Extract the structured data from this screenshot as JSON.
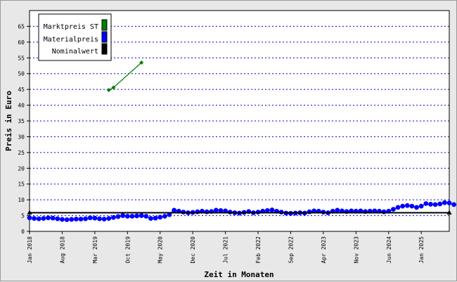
{
  "chart_data": {
    "type": "line",
    "xlabel": "Zeit in Monaten",
    "ylabel": "Preis in Euro",
    "ylim": [
      0,
      70
    ],
    "y_ticks": [
      0,
      5,
      10,
      15,
      20,
      25,
      30,
      35,
      40,
      45,
      50,
      55,
      60,
      65
    ],
    "x_range": [
      "2018-01",
      "2025-07"
    ],
    "x_ticks": [
      {
        "date": "2018-01",
        "label": "Jan 2018"
      },
      {
        "date": "2018-08",
        "label": "Aug 2018"
      },
      {
        "date": "2019-03",
        "label": "Mar 2019"
      },
      {
        "date": "2019-10",
        "label": "Oct 2019"
      },
      {
        "date": "2020-05",
        "label": "May 2020"
      },
      {
        "date": "2020-12",
        "label": "Dec 2020"
      },
      {
        "date": "2021-07",
        "label": "Jul 2021"
      },
      {
        "date": "2022-02",
        "label": "Feb 2022"
      },
      {
        "date": "2022-09",
        "label": "Sep 2022"
      },
      {
        "date": "2023-04",
        "label": "Apr 2023"
      },
      {
        "date": "2023-11",
        "label": "Nov 2023"
      },
      {
        "date": "2024-06",
        "label": "Jun 2024"
      },
      {
        "date": "2025-01",
        "label": "Jan 2025"
      }
    ],
    "grid": true,
    "legend_position": "top-left",
    "series": [
      {
        "name": "Marktpreis ST",
        "color": "#008000",
        "marker": "diamond",
        "points": [
          {
            "x": "2019-06",
            "y": 44.8
          },
          {
            "x": "2019-07",
            "y": 45.6
          },
          {
            "x": "2020-01",
            "y": 53.5
          }
        ]
      },
      {
        "name": "Materialpreis",
        "color": "#0000ff",
        "marker": "circle",
        "start": "2018-01",
        "values": [
          4.3,
          4.1,
          4.0,
          4.1,
          4.3,
          4.2,
          4.0,
          3.8,
          3.7,
          3.8,
          3.9,
          3.9,
          4.0,
          4.3,
          4.2,
          4.0,
          3.9,
          4.1,
          4.4,
          4.7,
          5.0,
          4.8,
          4.8,
          4.9,
          5.0,
          4.8,
          4.1,
          4.2,
          4.5,
          4.8,
          5.3,
          6.7,
          6.4,
          6.1,
          5.9,
          6.0,
          6.2,
          6.4,
          6.2,
          6.3,
          6.7,
          6.6,
          6.5,
          6.1,
          5.9,
          5.8,
          6.0,
          6.3,
          5.9,
          6.1,
          6.4,
          6.6,
          6.8,
          6.4,
          6.1,
          5.8,
          5.7,
          5.8,
          5.9,
          5.8,
          6.2,
          6.5,
          6.4,
          6.1,
          5.9,
          6.4,
          6.7,
          6.5,
          6.3,
          6.5,
          6.4,
          6.5,
          6.3,
          6.4,
          6.5,
          6.4,
          6.2,
          6.4,
          7.0,
          7.6,
          8.0,
          8.2,
          8.0,
          7.6,
          8.0,
          8.8,
          8.6,
          8.5,
          8.7,
          9.1,
          9.0,
          8.5
        ]
      },
      {
        "name": "Nominalwert",
        "color": "#000000",
        "marker": "triangle",
        "points": [
          {
            "x": "2018-01",
            "y": 5.9
          },
          {
            "x": "2025-07",
            "y": 5.9
          }
        ]
      }
    ]
  }
}
